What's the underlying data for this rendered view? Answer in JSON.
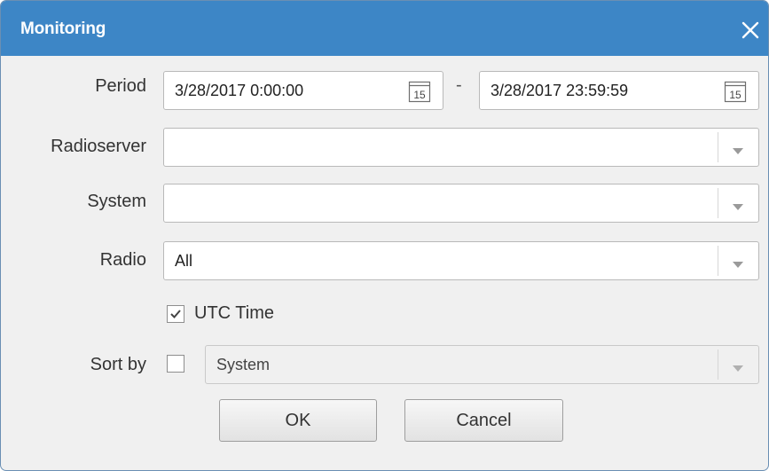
{
  "dialog": {
    "title": "Monitoring",
    "close_icon": "close-icon"
  },
  "period": {
    "label": "Period",
    "from_value": "3/28/2017 0:00:00",
    "separator": "-",
    "to_value": "3/28/2017 23:59:59",
    "calendar_icon_text": "15"
  },
  "radioserver": {
    "label": "Radioserver",
    "value": ""
  },
  "system": {
    "label": "System",
    "value": ""
  },
  "radio": {
    "label": "Radio",
    "value": "All"
  },
  "utc_time": {
    "label": "UTC Time",
    "checked": true
  },
  "sort_by": {
    "label": "Sort by",
    "checked": false,
    "value": "System"
  },
  "buttons": {
    "ok": "OK",
    "cancel": "Cancel"
  },
  "colors": {
    "titlebar": "#3d86c6",
    "title_text": "#ffffff",
    "dialog_bg": "#f0f0f0"
  }
}
